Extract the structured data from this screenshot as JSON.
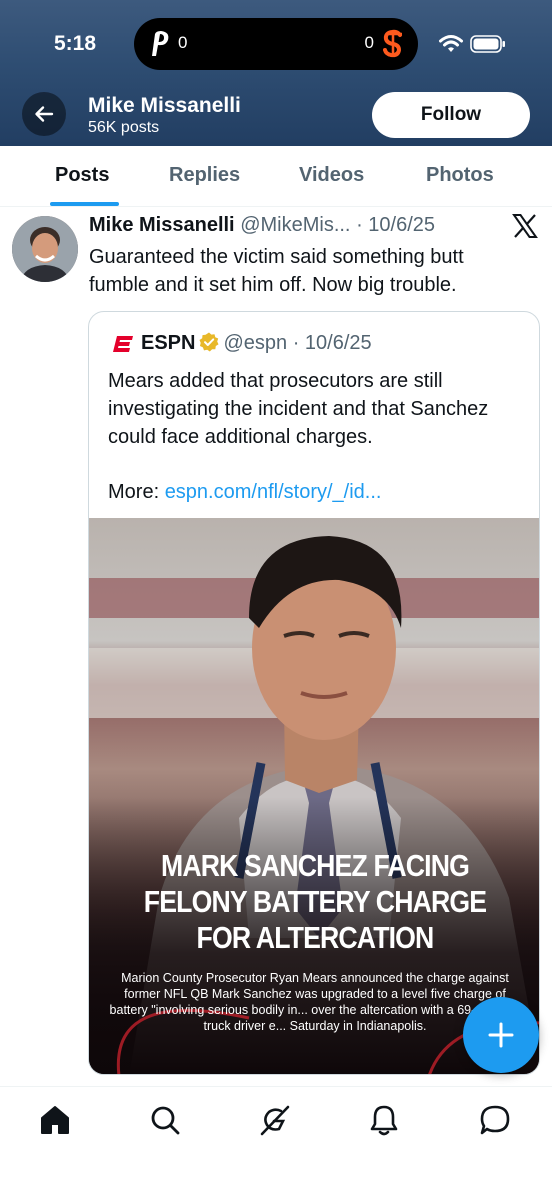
{
  "status_bar": {
    "time": "5:18",
    "score_left": "0",
    "score_right": "0",
    "left_team_icon": "phillies-logo-icon",
    "right_team_icon": "giants-logo-icon"
  },
  "profile_header": {
    "name": "Mike Missanelli",
    "posts_count": "56K posts",
    "follow_label": "Follow"
  },
  "tabs": [
    {
      "label": "Posts",
      "active": true
    },
    {
      "label": "Replies",
      "active": false
    },
    {
      "label": "Videos",
      "active": false
    },
    {
      "label": "Photos",
      "active": false
    }
  ],
  "tweet": {
    "author_name": "Mike Missanelli",
    "author_handle": "@MikeMis...",
    "date": "· 10/6/25",
    "text": "Guaranteed the victim said something butt fumble and it set him off. Now big trouble.",
    "quote": {
      "name": "ESPN",
      "handle": "@espn",
      "date": "· 10/6/25",
      "text": "Mears added that prosecutors are still investigating the incident and that Sanchez could face additional charges.",
      "more_label": "More: ",
      "link": "espn.com/nfl/story/_/id...",
      "media": {
        "headline_lines": [
          "MARK SANCHEZ FACING",
          "FELONY BATTERY CHARGE",
          "FOR ALTERCATION"
        ],
        "caption": "Marion County Prosecutor Ryan Mears announced the charge against former NFL QB Mark Sanchez was upgraded to a level five charge of battery \"involving serious bodily in... over the altercation with a 69-year-old truck driver e... Saturday in Indianapolis."
      }
    }
  },
  "colors": {
    "accent": "#1d9bf0",
    "header_bg": "#2e4d72",
    "espn_red": "#e4002b"
  },
  "bottom_nav": [
    "home-icon",
    "search-icon",
    "grok-icon",
    "notifications-icon",
    "messages-icon"
  ]
}
